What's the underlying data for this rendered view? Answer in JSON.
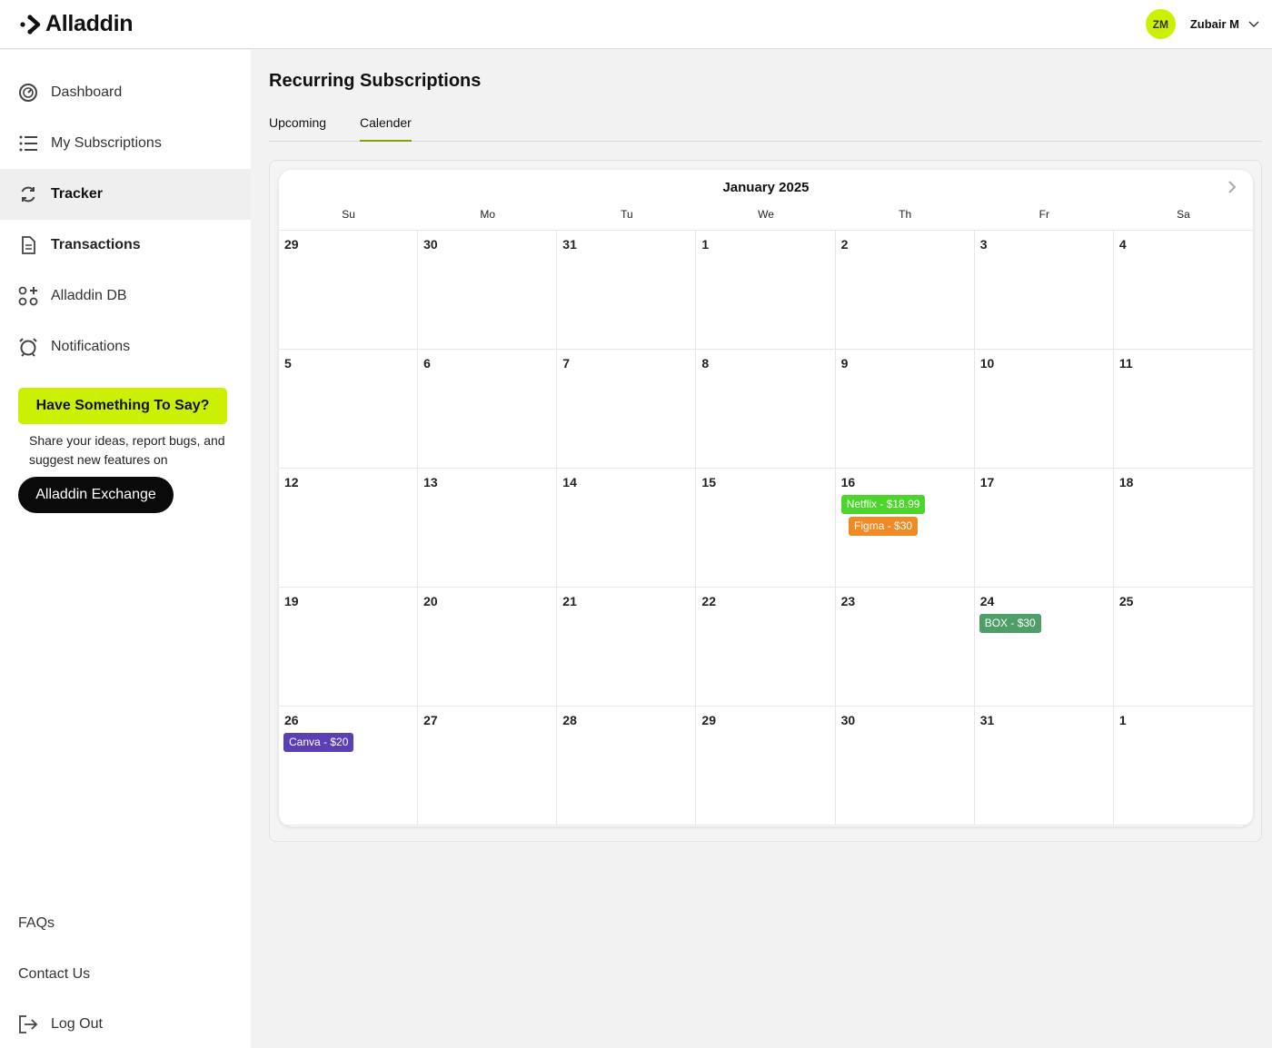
{
  "header": {
    "logo_text": "Alladdin",
    "user_initials": "ZM",
    "user_name": "Zubair M",
    "accent_color": "#cdf000"
  },
  "sidebar": {
    "items": [
      {
        "label": "Dashboard",
        "icon": "gauge-icon"
      },
      {
        "label": "My Subscriptions",
        "icon": "list-icon"
      },
      {
        "label": "Tracker",
        "icon": "refresh-icon",
        "active": true
      },
      {
        "label": "Transactions",
        "icon": "document-icon"
      },
      {
        "label": "Alladdin DB",
        "icon": "apps-icon"
      },
      {
        "label": "Notifications",
        "icon": "alarm-icon"
      }
    ],
    "feedback_button": "Have Something To Say?",
    "feedback_text": "Share your ideas, report bugs, and suggest new features on",
    "exchange_button": "Alladdin Exchange",
    "faqs": "FAQs",
    "contact": "Contact Us",
    "logout": "Log Out"
  },
  "main": {
    "title": "Recurring Subscriptions",
    "tabs": [
      {
        "label": "Upcoming"
      },
      {
        "label": "Calender",
        "active": true
      }
    ]
  },
  "calendar": {
    "month": "January 2025",
    "weekdays": [
      "Su",
      "Mo",
      "Tu",
      "We",
      "Th",
      "Fr",
      "Sa"
    ],
    "weeks": [
      [
        {
          "d": "29"
        },
        {
          "d": "30"
        },
        {
          "d": "31"
        },
        {
          "d": "1"
        },
        {
          "d": "2"
        },
        {
          "d": "3"
        },
        {
          "d": "4"
        }
      ],
      [
        {
          "d": "5"
        },
        {
          "d": "6"
        },
        {
          "d": "7"
        },
        {
          "d": "8"
        },
        {
          "d": "9"
        },
        {
          "d": "10"
        },
        {
          "d": "11"
        }
      ],
      [
        {
          "d": "12"
        },
        {
          "d": "13"
        },
        {
          "d": "14"
        },
        {
          "d": "15"
        },
        {
          "d": "16",
          "events": [
            {
              "label": "Netflix - $18.99",
              "color": "#4cd62b"
            },
            {
              "label": "Figma - $30",
              "color": "#f08a24"
            }
          ]
        },
        {
          "d": "17"
        },
        {
          "d": "18"
        }
      ],
      [
        {
          "d": "19"
        },
        {
          "d": "20"
        },
        {
          "d": "21"
        },
        {
          "d": "22"
        },
        {
          "d": "23"
        },
        {
          "d": "24",
          "events": [
            {
              "label": "BOX - $30",
              "color": "#4f9e68"
            }
          ]
        },
        {
          "d": "25"
        }
      ],
      [
        {
          "d": "26",
          "events": [
            {
              "label": "Canva - $20",
              "color": "#5b3fb5"
            }
          ]
        },
        {
          "d": "27"
        },
        {
          "d": "28"
        },
        {
          "d": "29"
        },
        {
          "d": "30"
        },
        {
          "d": "31"
        },
        {
          "d": "1"
        }
      ]
    ]
  }
}
